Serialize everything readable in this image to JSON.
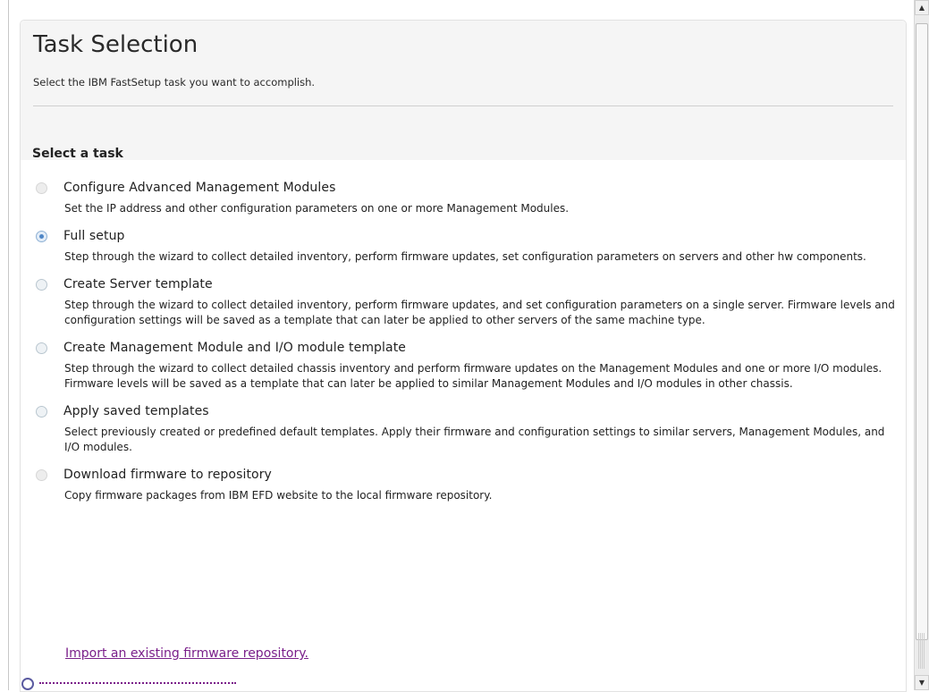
{
  "header": {
    "title": "Task Selection",
    "subtitle": "Select the IBM FastSetup task you want to accomplish."
  },
  "section": {
    "heading": "Select a task"
  },
  "tasks": [
    {
      "label": "Configure Advanced Management Modules",
      "description": "Set the IP address and other configuration parameters on one or more Management Modules.",
      "state": "disabled"
    },
    {
      "label": "Full setup",
      "description": "Step through the wizard to collect detailed inventory, perform firmware updates, set configuration parameters on servers and other hw components.",
      "state": "selected"
    },
    {
      "label": "Create Server template",
      "description": "Step through the wizard to collect detailed inventory, perform firmware updates, and set configuration parameters on a single server. Firmware levels and configuration settings will be saved as a template that can later be applied to other servers of the same machine type.",
      "state": "enabled"
    },
    {
      "label": "Create Management Module and I/O module template",
      "description": "Step through the wizard to collect detailed chassis inventory and perform firmware updates on the Management Modules and one or more I/O modules. Firmware levels will be saved as a template that can later be applied to similar Management Modules and I/O modules in other chassis.",
      "state": "enabled"
    },
    {
      "label": "Apply saved templates",
      "description": "Select previously created or predefined default templates. Apply their firmware and configuration settings to similar servers, Management Modules, and I/O modules.",
      "state": "enabled"
    },
    {
      "label": "Download firmware to repository",
      "description": "Copy firmware packages from IBM EFD website to the local firmware repository.",
      "state": "disabled"
    }
  ],
  "links": {
    "import_repository": "Import an existing firmware repository."
  },
  "colors": {
    "link": "#7a1f8a",
    "header_background": "#f5f5f5",
    "radio_selected": "#4f86c6"
  },
  "icons": {
    "scroll_up": "scroll-up-arrow-icon",
    "scroll_down": "scroll-down-arrow-icon",
    "partial_link": "help-circle-icon"
  }
}
